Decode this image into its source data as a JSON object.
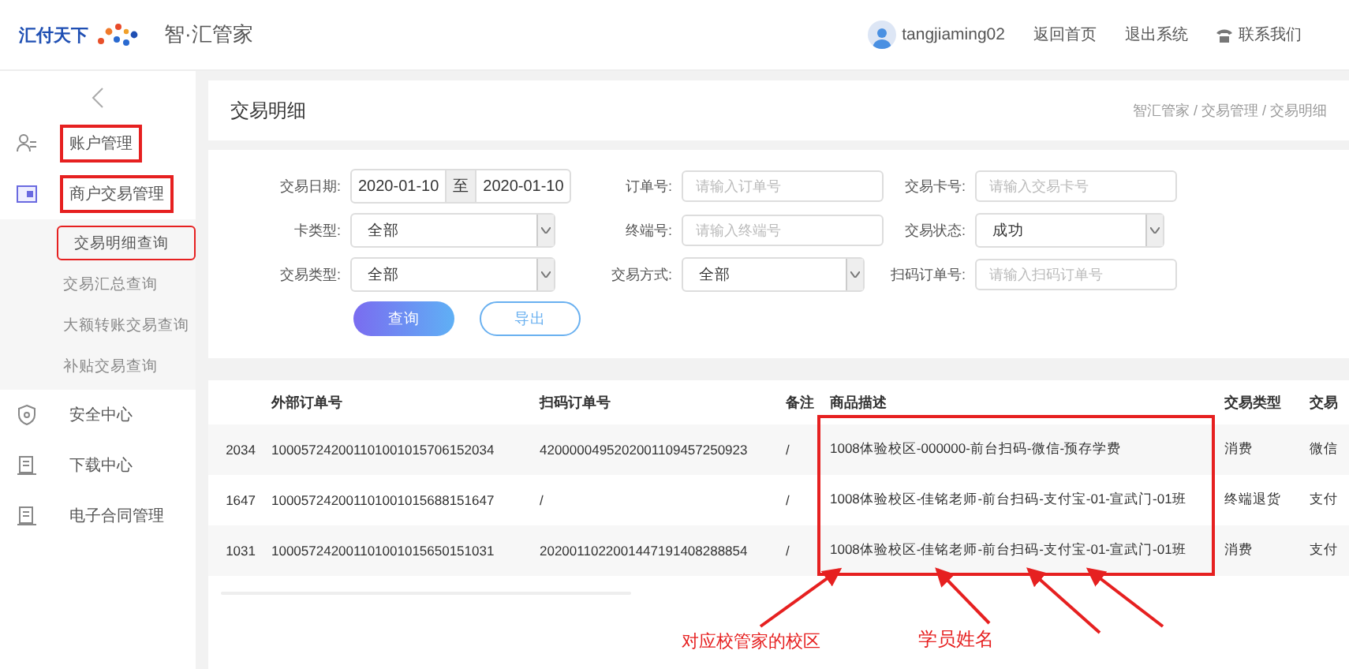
{
  "header": {
    "brand": "汇付天下",
    "product": "智·汇管家",
    "user": "tangjiaming02",
    "links": [
      {
        "label": "返回首页",
        "kind": "plain"
      },
      {
        "label": "退出系统",
        "kind": "plain"
      },
      {
        "label": "联系我们",
        "kind": "phone"
      }
    ]
  },
  "sidebar": {
    "items": [
      {
        "label": "账户管理",
        "annotated": true
      },
      {
        "label": "商户交易管理",
        "annotated": true,
        "children": [
          {
            "label": "交易明细查询",
            "selected": true,
            "annotated": true
          },
          {
            "label": "交易汇总查询",
            "selected": false,
            "annotated": false
          },
          {
            "label": "大额转账交易查询",
            "selected": false,
            "annotated": false
          },
          {
            "label": "补贴交易查询",
            "selected": false,
            "annotated": false
          }
        ]
      },
      {
        "label": "安全中心",
        "annotated": false
      },
      {
        "label": "下载中心",
        "annotated": false
      },
      {
        "label": "电子合同管理",
        "annotated": false
      }
    ]
  },
  "page": {
    "title": "交易明细",
    "breadcrumb": "智汇管家 / 交易管理 / 交易明细"
  },
  "filters": [
    {
      "label": "交易日期:",
      "kind": "daterange",
      "from": "2020-01-10",
      "sep": "至",
      "to": "2020-01-10"
    },
    {
      "label": "订单号:",
      "kind": "text",
      "placeholder": "请输入订单号"
    },
    {
      "label": "交易卡号:",
      "kind": "text",
      "placeholder": "请输入交易卡号"
    },
    {
      "label": "卡类型:",
      "kind": "select",
      "value": "全部"
    },
    {
      "label": "终端号:",
      "kind": "text",
      "placeholder": "请输入终端号"
    },
    {
      "label": "交易状态:",
      "kind": "select",
      "value": "成功"
    },
    {
      "label": "交易类型:",
      "kind": "select",
      "value": "全部"
    },
    {
      "label": "交易方式:",
      "kind": "select",
      "value": "全部"
    },
    {
      "label": "扫码订单号:",
      "kind": "text",
      "placeholder": "请输入扫码订单号"
    }
  ],
  "buttons": [
    {
      "label": "查询",
      "kind": "primary"
    },
    {
      "label": "导出",
      "kind": "outline"
    }
  ],
  "table": {
    "columns": [
      "",
      "外部订单号",
      "扫码订单号",
      "备注",
      "商品描述",
      "交易类型",
      "交易"
    ],
    "rows": [
      [
        "2034",
        "100057242001101001015706152034",
        "4200000495202001109457250923",
        "/",
        "1008体验校区-000000-前台扫码-微信-预存学费",
        "消费",
        "微信"
      ],
      [
        "1647",
        "100057242001101001015688151647",
        "/",
        "/",
        "1008体验校区-佳铭老师-前台扫码-支付宝-01-宣武门-01班",
        "终端退货",
        "支付"
      ],
      [
        "1031",
        "100057242001101001015650151031",
        "2020011022001447191408288854",
        "/",
        "1008体验校区-佳铭老师-前台扫码-支付宝-01-宣武门-01班",
        "消费",
        "支付"
      ]
    ]
  },
  "annotations": [
    {
      "text": "对应校管家的校区"
    },
    {
      "text": "学员姓名"
    }
  ]
}
